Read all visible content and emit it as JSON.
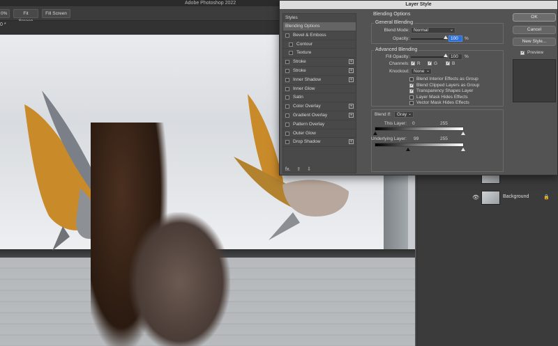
{
  "app": {
    "title": "Adobe Photoshop 2022"
  },
  "options_bar": {
    "zoom_value": "0%",
    "fit_screen_label": "Fit Screen",
    "fill_screen_label": "Fill Screen"
  },
  "doc_tab": {
    "label": "0 *"
  },
  "layers": {
    "items": [
      {
        "name": ""
      },
      {
        "name": "Background"
      }
    ]
  },
  "dialog": {
    "title": "Layer Style",
    "styles_header": "Styles",
    "styles": [
      {
        "label": "Blending Options",
        "active": true,
        "checkbox": false,
        "plus": false,
        "indent": false
      },
      {
        "label": "Bevel & Emboss",
        "checkbox": true,
        "plus": false,
        "indent": false
      },
      {
        "label": "Contour",
        "checkbox": true,
        "plus": false,
        "indent": true
      },
      {
        "label": "Texture",
        "checkbox": true,
        "plus": false,
        "indent": true
      },
      {
        "label": "Stroke",
        "checkbox": true,
        "plus": true,
        "indent": false
      },
      {
        "label": "Stroke",
        "checkbox": true,
        "plus": true,
        "indent": false
      },
      {
        "label": "Inner Shadow",
        "checkbox": true,
        "plus": true,
        "indent": false
      },
      {
        "label": "Inner Glow",
        "checkbox": true,
        "plus": false,
        "indent": false
      },
      {
        "label": "Satin",
        "checkbox": true,
        "plus": false,
        "indent": false
      },
      {
        "label": "Color Overlay",
        "checkbox": true,
        "plus": true,
        "indent": false
      },
      {
        "label": "Gradient Overlay",
        "checkbox": true,
        "plus": true,
        "indent": false
      },
      {
        "label": "Pattern Overlay",
        "checkbox": true,
        "plus": false,
        "indent": false
      },
      {
        "label": "Outer Glow",
        "checkbox": true,
        "plus": false,
        "indent": false
      },
      {
        "label": "Drop Shadow",
        "checkbox": true,
        "plus": true,
        "indent": false
      }
    ],
    "footer_fx": "fx.",
    "blending": {
      "title": "Blending Options",
      "general_title": "General Blending",
      "blend_mode_label": "Blend Mode:",
      "blend_mode_value": "Normal",
      "opacity_label": "Opacity:",
      "opacity_value": "100",
      "pct": "%",
      "advanced_title": "Advanced Blending",
      "fill_opacity_label": "Fill Opacity:",
      "fill_opacity_value": "100",
      "channels_label": "Channels:",
      "channel_r": "R",
      "channel_g": "G",
      "channel_b": "B",
      "knockout_label": "Knockout:",
      "knockout_value": "None",
      "options": [
        {
          "label": "Blend Interior Effects as Group",
          "checked": false
        },
        {
          "label": "Blend Clipped Layers as Group",
          "checked": true
        },
        {
          "label": "Transparency Shapes Layer",
          "checked": true
        },
        {
          "label": "Layer Mask Hides Effects",
          "checked": false
        },
        {
          "label": "Vector Mask Hides Effects",
          "checked": false
        }
      ],
      "blend_if_label": "Blend If:",
      "blend_if_value": "Gray",
      "this_layer_label": "This Layer:",
      "this_layer_low": "0",
      "this_layer_high": "255",
      "underlying_label": "Underlying Layer:",
      "underlying_low": "99",
      "underlying_high": "255"
    },
    "buttons": {
      "ok": "OK",
      "cancel": "Cancel",
      "new_style": "New Style...",
      "preview": "Preview"
    }
  }
}
